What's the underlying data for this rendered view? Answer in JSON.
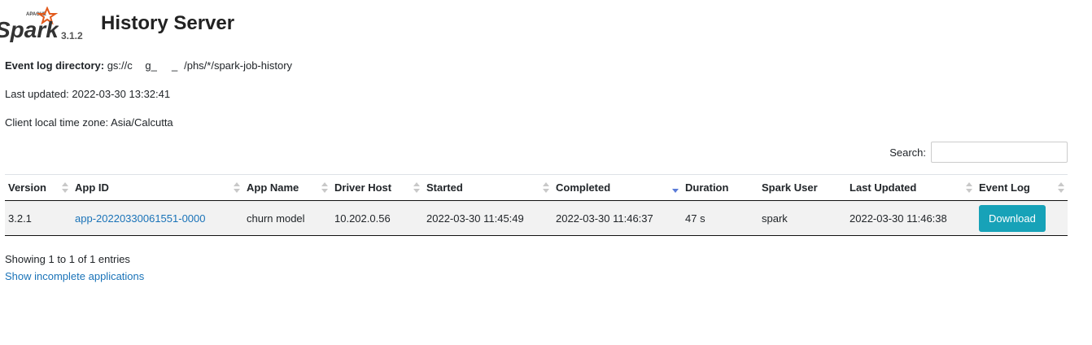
{
  "header": {
    "logo_word": "Spark",
    "logo_small": "APACHE",
    "spark_version": "3.1.2",
    "title": "History Server"
  },
  "info": {
    "event_log_label": "Event log directory:",
    "event_log_value": "gs://c      g_       _   /phs/*/spark-job-history",
    "last_updated": "Last updated: 2022-03-30 13:32:41",
    "timezone": "Client local time zone: Asia/Calcutta"
  },
  "search": {
    "label": "Search:",
    "value": ""
  },
  "table": {
    "columns": [
      "Version",
      "App ID",
      "App Name",
      "Driver Host",
      "Started",
      "Completed",
      "Duration",
      "Spark User",
      "Last Updated",
      "Event Log"
    ],
    "rows": [
      {
        "version": "3.2.1",
        "app_id": "app-20220330061551-0000",
        "app_name": "churn model",
        "driver_host": "10.202.0.56",
        "started": "2022-03-30 11:45:49",
        "completed": "2022-03-30 11:46:37",
        "duration": "47 s",
        "spark_user": "spark",
        "last_updated": "2022-03-30 11:46:38",
        "event_log_button": "Download"
      }
    ],
    "sorted_column": "Completed",
    "sort_direction": "descending"
  },
  "footer": {
    "showing": "Showing 1 to 1 of 1 entries",
    "incomplete_link": "Show incomplete applications"
  },
  "colors": {
    "accent_link": "#1a73b8",
    "download_button": "#17a2b8",
    "logo_orange": "#e25a1c"
  }
}
